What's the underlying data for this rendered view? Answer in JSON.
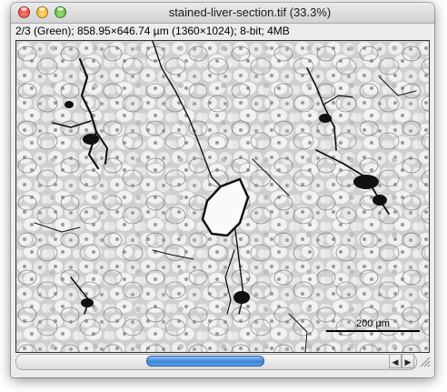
{
  "window": {
    "title": "stained-liver-section.tif (33.3%)",
    "info": "2/3 (Green); 858.95×646.74 µm (1360×1024); 8-bit; 4MB"
  },
  "image": {
    "scale_label": "200 µm",
    "description_colors": {
      "background": "#cfcfcf",
      "cell": "#f2f2f2",
      "stain": "#111111"
    }
  },
  "scrollbar": {
    "left_arrow": "◀",
    "right_arrow": "▶",
    "thumb_color": "#3a84dc"
  }
}
